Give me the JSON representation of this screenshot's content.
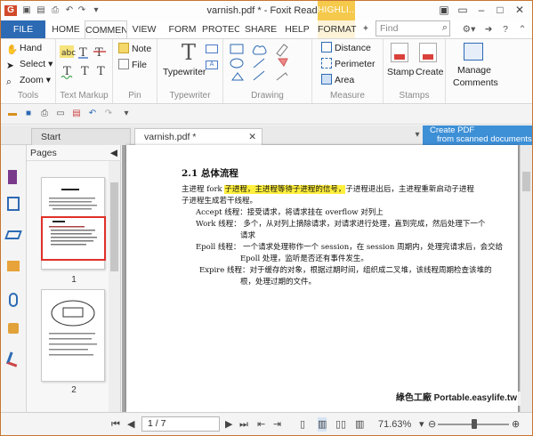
{
  "window": {
    "title": "varnish.pdf * - Foxit Reader",
    "hilite_tab": "HIGHLI..."
  },
  "ribbon_tabs": [
    "FILE",
    "HOME",
    "COMMENT",
    "VIEW",
    "FORM",
    "PROTECT",
    "SHARE",
    "HELP",
    "FORMAT"
  ],
  "search": {
    "placeholder": "Find"
  },
  "ribbon": {
    "tools": {
      "label": "Tools",
      "hand": "Hand",
      "select": "Select",
      "zoom": "Zoom"
    },
    "text_markup": {
      "label": "Text Markup"
    },
    "pin": {
      "label": "Pin",
      "note": "Note",
      "file": "File"
    },
    "typewriter": {
      "label": "Typewriter",
      "button": "Typewriter"
    },
    "drawing": {
      "label": "Drawing"
    },
    "measure": {
      "label": "Measure",
      "distance": "Distance",
      "perimeter": "Perimeter",
      "area": "Area"
    },
    "stamps": {
      "label": "Stamps",
      "stamp": "Stamp",
      "create": "Create"
    },
    "manage": {
      "label": "Manage Comments",
      "line1": "Manage",
      "line2": "Comments"
    }
  },
  "doc_tabs": {
    "start": "Start",
    "active": "varnish.pdf *"
  },
  "ad": {
    "line1": "Create PDF",
    "line2": "from scanned documents"
  },
  "pages_panel": {
    "title": "Pages",
    "thumbs": [
      {
        "num": "1"
      },
      {
        "num": "2"
      }
    ]
  },
  "page_content": {
    "heading": "2.1 总体流程",
    "lines": [
      "主进程 fork ",
      "子进程，主进程等待子进程的信号，",
      "子进程退出后，主进程重新启动子进程",
      "子进程生成若干线程。",
      "Accept 线程：接受请求，将请求挂在 overflow 对列上",
      "Work 线程：    多个，从对列上摘除请求，对请求进行处理，直到完成，然后处理下一个",
      "请求",
      "Epoll 线程：   一个请求处理称作一个 session，在 session 周期内，处理完请求后，会交给",
      "Epoll 处理，监听是否还有事件发生。",
      "Expire 线程：对于缓存的对象，根据过期时间，组织成二叉堆，该线程周期检查该堆的",
      "根，处理过期的文件。"
    ]
  },
  "status": {
    "page": "1 / 7",
    "zoom": "71.63%"
  },
  "watermark": "綠色工廠 Portable.easylife.tw",
  "colors": {
    "file_tab": "#2d6ab4",
    "highlight": "#ffef3d",
    "accent_border": "#c87533"
  }
}
